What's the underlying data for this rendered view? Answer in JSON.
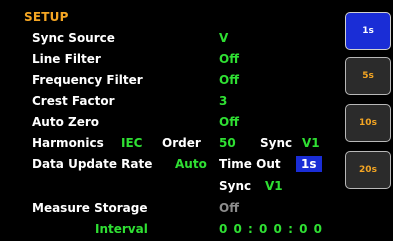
{
  "title": "SETUP",
  "rows": {
    "sync_source": {
      "label": "Sync Source",
      "value": "V"
    },
    "line_filter": {
      "label": "Line Filter",
      "value": "Off"
    },
    "frequency_filter": {
      "label": "Frequency Filter",
      "value": "Off"
    },
    "crest_factor": {
      "label": "Crest Factor",
      "value": "3"
    },
    "auto_zero": {
      "label": "Auto Zero",
      "value": "Off"
    },
    "harmonics": {
      "label": "Harmonics",
      "standard": "IEC",
      "order_label": "Order",
      "order_value": "50",
      "sync_label": "Sync",
      "sync_value": "V1"
    },
    "data_update_rate": {
      "label": "Data Update Rate",
      "value": "Auto",
      "timeout_label": "Time Out",
      "timeout_value": "1s",
      "sync_label": "Sync",
      "sync_value": "V1"
    },
    "measure_storage": {
      "label": "Measure Storage",
      "value": "Off",
      "interval_label": "Interval",
      "interval_value": "0 0 : 0 0 : 0 0"
    }
  },
  "softkeys": [
    {
      "label": "1s",
      "active": true
    },
    {
      "label": "5s",
      "active": false
    },
    {
      "label": "10s",
      "active": false
    },
    {
      "label": "20s",
      "active": false
    }
  ],
  "colors": {
    "title": "#f5a623",
    "value": "#2fe033",
    "selected_bg": "#1a2dd6",
    "disabled": "#8c8c8c"
  }
}
